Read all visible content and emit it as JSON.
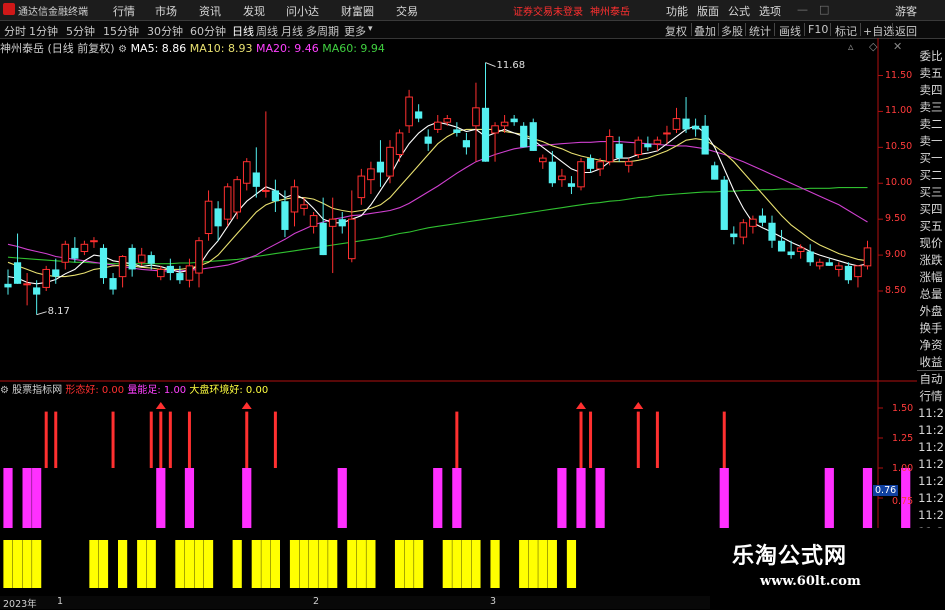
{
  "app": {
    "title": "通达信金融终端",
    "menu": [
      "行情",
      "市场",
      "资讯",
      "发现",
      "问小达",
      "财富圈",
      "交易"
    ],
    "notice": "证券交易未登录",
    "stock_tab": "神州泰岳",
    "right_menu": [
      "功能",
      "版面",
      "公式",
      "选项",
      "游客"
    ]
  },
  "toolbar": {
    "periods": [
      "分时",
      "1分钟",
      "5分钟",
      "15分钟",
      "30分钟",
      "60分钟",
      "日线",
      "周线",
      "月线",
      "多周期",
      "更多"
    ],
    "active_period": "日线",
    "tools": [
      "复权",
      "叠加",
      "多股",
      "统计",
      "画线",
      "F10",
      "标记",
      "+自选",
      "返回"
    ]
  },
  "info": {
    "stock": "神州泰岳",
    "mode": "(日线 前复权)",
    "ma5": "MA5: 8.86",
    "ma10": "MA10: 8.93",
    "ma20": "MA20: 9.46",
    "ma60": "MA60: 9.94"
  },
  "price_axis": [
    "11.50",
    "11.00",
    "10.50",
    "10.00",
    "9.50",
    "9.00",
    "8.50"
  ],
  "annotations": {
    "high": "11.68",
    "low": "8.17"
  },
  "indicator": {
    "name": "股票指标网",
    "l1": "形态好: 0.00",
    "l2": "量能足: 1.00",
    "l3": "大盘环境好: 0.00",
    "axis": [
      "1.50",
      "1.25",
      "1.00",
      "0.75"
    ],
    "current_value": "0.76"
  },
  "side_panel": [
    "委比",
    "卖五",
    "卖四",
    "卖三",
    "卖二",
    "卖一",
    "买一",
    "买二",
    "买三",
    "买四",
    "买五",
    "现价",
    "涨跌",
    "涨幅",
    "总量",
    "外盘",
    "换手",
    "净资",
    "收益",
    "自动",
    "行情",
    "11:2",
    "11:2",
    "11:2",
    "11:2",
    "11:2",
    "11:2",
    "11:2",
    "11:2"
  ],
  "bottom_axis": {
    "year": "2023年",
    "months": [
      "1",
      "2",
      "3"
    ]
  },
  "watermark": {
    "line1": "乐淘公式网",
    "line2": "www.60lt.com"
  },
  "colors": {
    "up": "#ff3030",
    "down": "#54f0f0",
    "ma5": "#ffffff",
    "ma10": "#e8e070",
    "ma20": "#d040d0",
    "ma60": "#30c030",
    "magenta": "#ff30ff",
    "yellow": "#ffff00",
    "axis": "#b01010"
  },
  "chart_data": {
    "type": "candlestick",
    "price_range": [
      8.17,
      11.68
    ],
    "candles": [
      {
        "o": 8.6,
        "h": 8.8,
        "l": 8.45,
        "c": 8.55
      },
      {
        "o": 8.9,
        "h": 9.3,
        "l": 8.6,
        "c": 8.6
      },
      {
        "o": 8.6,
        "h": 8.75,
        "l": 8.3,
        "c": 8.6
      },
      {
        "o": 8.55,
        "h": 8.65,
        "l": 8.17,
        "c": 8.45
      },
      {
        "o": 8.55,
        "h": 8.85,
        "l": 8.5,
        "c": 8.8
      },
      {
        "o": 8.8,
        "h": 8.95,
        "l": 8.6,
        "c": 8.7
      },
      {
        "o": 8.9,
        "h": 9.2,
        "l": 8.8,
        "c": 9.15
      },
      {
        "o": 9.1,
        "h": 9.25,
        "l": 8.9,
        "c": 8.95
      },
      {
        "o": 9.05,
        "h": 9.2,
        "l": 9.0,
        "c": 9.15
      },
      {
        "o": 9.2,
        "h": 9.25,
        "l": 9.1,
        "c": 9.2
      },
      {
        "o": 9.1,
        "h": 9.15,
        "l": 8.6,
        "c": 8.68
      },
      {
        "o": 8.68,
        "h": 8.75,
        "l": 8.45,
        "c": 8.52
      },
      {
        "o": 8.7,
        "h": 9.0,
        "l": 8.55,
        "c": 8.98
      },
      {
        "o": 9.1,
        "h": 9.15,
        "l": 8.7,
        "c": 8.8
      },
      {
        "o": 8.9,
        "h": 9.1,
        "l": 8.85,
        "c": 9.0
      },
      {
        "o": 9.0,
        "h": 9.05,
        "l": 8.8,
        "c": 8.88
      },
      {
        "o": 8.7,
        "h": 8.85,
        "l": 8.65,
        "c": 8.8
      },
      {
        "o": 8.85,
        "h": 8.95,
        "l": 8.65,
        "c": 8.75
      },
      {
        "o": 8.75,
        "h": 8.85,
        "l": 8.6,
        "c": 8.65
      },
      {
        "o": 8.65,
        "h": 8.95,
        "l": 8.55,
        "c": 8.85
      },
      {
        "o": 8.75,
        "h": 9.25,
        "l": 8.55,
        "c": 9.2
      },
      {
        "o": 9.3,
        "h": 9.9,
        "l": 9.2,
        "c": 9.75
      },
      {
        "o": 9.65,
        "h": 9.75,
        "l": 9.2,
        "c": 9.4
      },
      {
        "o": 9.5,
        "h": 10.0,
        "l": 9.4,
        "c": 9.95
      },
      {
        "o": 9.6,
        "h": 10.1,
        "l": 9.5,
        "c": 10.05
      },
      {
        "o": 10.0,
        "h": 10.35,
        "l": 9.9,
        "c": 10.3
      },
      {
        "o": 10.15,
        "h": 10.5,
        "l": 9.8,
        "c": 9.95
      },
      {
        "o": 9.9,
        "h": 11.0,
        "l": 9.8,
        "c": 9.9
      },
      {
        "o": 9.9,
        "h": 10.05,
        "l": 9.6,
        "c": 9.75
      },
      {
        "o": 9.75,
        "h": 9.9,
        "l": 9.25,
        "c": 9.35
      },
      {
        "o": 9.6,
        "h": 10.05,
        "l": 9.4,
        "c": 9.95
      },
      {
        "o": 9.65,
        "h": 9.8,
        "l": 9.55,
        "c": 9.7
      },
      {
        "o": 9.4,
        "h": 9.6,
        "l": 9.3,
        "c": 9.55
      },
      {
        "o": 9.45,
        "h": 9.8,
        "l": 9.0,
        "c": 9.0
      },
      {
        "o": 9.4,
        "h": 9.8,
        "l": 8.75,
        "c": 9.5
      },
      {
        "o": 9.5,
        "h": 9.6,
        "l": 9.3,
        "c": 9.4
      },
      {
        "o": 8.95,
        "h": 9.9,
        "l": 8.9,
        "c": 9.5
      },
      {
        "o": 9.8,
        "h": 10.2,
        "l": 9.7,
        "c": 10.1
      },
      {
        "o": 10.05,
        "h": 10.3,
        "l": 9.85,
        "c": 10.2
      },
      {
        "o": 10.3,
        "h": 10.6,
        "l": 9.95,
        "c": 10.15
      },
      {
        "o": 10.1,
        "h": 10.6,
        "l": 10.0,
        "c": 10.5
      },
      {
        "o": 10.4,
        "h": 10.75,
        "l": 10.3,
        "c": 10.7
      },
      {
        "o": 10.8,
        "h": 11.3,
        "l": 10.7,
        "c": 11.2
      },
      {
        "o": 11.0,
        "h": 11.1,
        "l": 10.85,
        "c": 10.9
      },
      {
        "o": 10.65,
        "h": 10.75,
        "l": 10.45,
        "c": 10.55
      },
      {
        "o": 10.75,
        "h": 10.95,
        "l": 10.7,
        "c": 10.85
      },
      {
        "o": 10.85,
        "h": 10.95,
        "l": 10.8,
        "c": 10.9
      },
      {
        "o": 10.75,
        "h": 10.85,
        "l": 10.65,
        "c": 10.7
      },
      {
        "o": 10.6,
        "h": 10.7,
        "l": 10.4,
        "c": 10.5
      },
      {
        "o": 10.8,
        "h": 11.4,
        "l": 10.3,
        "c": 11.05
      },
      {
        "o": 11.05,
        "h": 11.68,
        "l": 10.3,
        "c": 10.3
      },
      {
        "o": 10.7,
        "h": 10.85,
        "l": 10.3,
        "c": 10.8
      },
      {
        "o": 10.8,
        "h": 10.95,
        "l": 10.7,
        "c": 10.85
      },
      {
        "o": 10.9,
        "h": 10.95,
        "l": 10.8,
        "c": 10.85
      },
      {
        "o": 10.8,
        "h": 10.85,
        "l": 10.5,
        "c": 10.5
      },
      {
        "o": 10.85,
        "h": 10.9,
        "l": 10.45,
        "c": 10.45
      },
      {
        "o": 10.3,
        "h": 10.4,
        "l": 10.2,
        "c": 10.35
      },
      {
        "o": 10.3,
        "h": 10.45,
        "l": 9.95,
        "c": 10.0
      },
      {
        "o": 10.05,
        "h": 10.2,
        "l": 9.95,
        "c": 10.1
      },
      {
        "o": 10.0,
        "h": 10.1,
        "l": 9.85,
        "c": 9.95
      },
      {
        "o": 9.95,
        "h": 10.35,
        "l": 9.9,
        "c": 10.3
      },
      {
        "o": 10.35,
        "h": 10.4,
        "l": 10.15,
        "c": 10.2
      },
      {
        "o": 10.2,
        "h": 10.35,
        "l": 10.1,
        "c": 10.3
      },
      {
        "o": 10.3,
        "h": 10.75,
        "l": 10.25,
        "c": 10.65
      },
      {
        "o": 10.55,
        "h": 10.65,
        "l": 10.3,
        "c": 10.35
      },
      {
        "o": 10.25,
        "h": 10.35,
        "l": 10.15,
        "c": 10.3
      },
      {
        "o": 10.4,
        "h": 10.65,
        "l": 10.35,
        "c": 10.6
      },
      {
        "o": 10.55,
        "h": 10.65,
        "l": 10.45,
        "c": 10.5
      },
      {
        "o": 10.55,
        "h": 10.65,
        "l": 10.45,
        "c": 10.6
      },
      {
        "o": 10.7,
        "h": 10.8,
        "l": 10.55,
        "c": 10.7
      },
      {
        "o": 10.75,
        "h": 11.05,
        "l": 10.7,
        "c": 10.9
      },
      {
        "o": 10.9,
        "h": 11.2,
        "l": 10.7,
        "c": 10.75
      },
      {
        "o": 10.8,
        "h": 10.9,
        "l": 10.65,
        "c": 10.75
      },
      {
        "o": 10.8,
        "h": 10.95,
        "l": 10.4,
        "c": 10.4
      },
      {
        "o": 10.25,
        "h": 10.3,
        "l": 10.05,
        "c": 10.05
      },
      {
        "o": 10.05,
        "h": 10.1,
        "l": 9.35,
        "c": 9.35
      },
      {
        "o": 9.3,
        "h": 9.4,
        "l": 9.15,
        "c": 9.25
      },
      {
        "o": 9.25,
        "h": 9.5,
        "l": 9.15,
        "c": 9.45
      },
      {
        "o": 9.4,
        "h": 9.55,
        "l": 9.3,
        "c": 9.5
      },
      {
        "o": 9.55,
        "h": 9.65,
        "l": 9.4,
        "c": 9.45
      },
      {
        "o": 9.45,
        "h": 9.55,
        "l": 9.1,
        "c": 9.2
      },
      {
        "o": 9.2,
        "h": 9.35,
        "l": 9.05,
        "c": 9.05
      },
      {
        "o": 9.05,
        "h": 9.2,
        "l": 8.95,
        "c": 9.0
      },
      {
        "o": 9.05,
        "h": 9.15,
        "l": 8.95,
        "c": 9.1
      },
      {
        "o": 9.05,
        "h": 9.15,
        "l": 8.85,
        "c": 8.9
      },
      {
        "o": 8.85,
        "h": 8.95,
        "l": 8.8,
        "c": 8.9
      },
      {
        "o": 8.9,
        "h": 8.95,
        "l": 8.85,
        "c": 8.85
      },
      {
        "o": 8.8,
        "h": 8.9,
        "l": 8.7,
        "c": 8.85
      },
      {
        "o": 8.85,
        "h": 8.9,
        "l": 8.6,
        "c": 8.65
      },
      {
        "o": 8.7,
        "h": 8.85,
        "l": 8.55,
        "c": 8.85
      },
      {
        "o": 8.85,
        "h": 9.2,
        "l": 8.8,
        "c": 9.1
      }
    ],
    "ma5": [
      8.7,
      8.68,
      8.62,
      8.6,
      8.62,
      8.66,
      8.74,
      8.8,
      8.92,
      9.0,
      8.98,
      8.92,
      8.9,
      8.88,
      8.84,
      8.86,
      8.84,
      8.8,
      8.76,
      8.79,
      8.85,
      9.05,
      9.2,
      9.4,
      9.6,
      9.75,
      9.85,
      9.95,
      9.9,
      9.8,
      9.85,
      9.78,
      9.65,
      9.5,
      9.45,
      9.45,
      9.5,
      9.55,
      9.7,
      9.9,
      10.1,
      10.35,
      10.55,
      10.7,
      10.8,
      10.85,
      10.82,
      10.78,
      10.72,
      10.75,
      10.65,
      10.7,
      10.75,
      10.7,
      10.65,
      10.6,
      10.5,
      10.4,
      10.3,
      10.2,
      10.15,
      10.15,
      10.2,
      10.3,
      10.35,
      10.35,
      10.4,
      10.42,
      10.45,
      10.55,
      10.65,
      10.75,
      10.8,
      10.7,
      10.5,
      10.2,
      9.9,
      9.65,
      9.45,
      9.38,
      9.32,
      9.25,
      9.18,
      9.12,
      9.05,
      9.0,
      8.96,
      8.92,
      8.88,
      8.85,
      8.88
    ],
    "ma10": [
      8.9,
      8.85,
      8.8,
      8.75,
      8.72,
      8.7,
      8.7,
      8.72,
      8.75,
      8.8,
      8.82,
      8.85,
      8.86,
      8.85,
      8.83,
      8.82,
      8.8,
      8.8,
      8.8,
      8.82,
      8.85,
      8.9,
      9.0,
      9.15,
      9.3,
      9.45,
      9.6,
      9.7,
      9.75,
      9.78,
      9.8,
      9.8,
      9.78,
      9.72,
      9.65,
      9.62,
      9.6,
      9.62,
      9.65,
      9.7,
      9.8,
      9.95,
      10.1,
      10.25,
      10.4,
      10.55,
      10.65,
      10.72,
      10.75,
      10.75,
      10.75,
      10.75,
      10.72,
      10.7,
      10.68,
      10.62,
      10.58,
      10.52,
      10.48,
      10.42,
      10.38,
      10.35,
      10.32,
      10.3,
      10.3,
      10.3,
      10.32,
      10.35,
      10.4,
      10.45,
      10.52,
      10.6,
      10.62,
      10.6,
      10.52,
      10.42,
      10.3,
      10.15,
      10.0,
      9.85,
      9.7,
      9.55,
      9.42,
      9.32,
      9.22,
      9.14,
      9.08,
      9.02,
      8.98,
      8.94,
      8.92
    ],
    "ma20": [
      9.15,
      9.12,
      9.08,
      9.05,
      9.02,
      8.98,
      8.96,
      8.94,
      8.92,
      8.9,
      8.88,
      8.86,
      8.84,
      8.82,
      8.8,
      8.79,
      8.78,
      8.78,
      8.78,
      8.79,
      8.8,
      8.82,
      8.84,
      8.86,
      8.9,
      8.95,
      9.0,
      9.08,
      9.15,
      9.22,
      9.3,
      9.36,
      9.42,
      9.46,
      9.5,
      9.52,
      9.55,
      9.56,
      9.58,
      9.6,
      9.62,
      9.66,
      9.72,
      9.8,
      9.88,
      9.96,
      10.05,
      10.14,
      10.22,
      10.3,
      10.35,
      10.4,
      10.44,
      10.48,
      10.5,
      10.52,
      10.53,
      10.54,
      10.55,
      10.56,
      10.57,
      10.57,
      10.58,
      10.58,
      10.58,
      10.57,
      10.56,
      10.55,
      10.54,
      10.53,
      10.52,
      10.52,
      10.5,
      10.48,
      10.44,
      10.4,
      10.35,
      10.3,
      10.24,
      10.18,
      10.12,
      10.06,
      10.0,
      9.94,
      9.88,
      9.82,
      9.76,
      9.7,
      9.62,
      9.54,
      9.46
    ],
    "ma60": [
      8.97,
      8.96,
      8.95,
      8.94,
      8.93,
      8.92,
      8.91,
      8.9,
      8.9,
      8.89,
      8.89,
      8.88,
      8.88,
      8.88,
      8.88,
      8.88,
      8.88,
      8.88,
      8.89,
      8.89,
      8.9,
      8.91,
      8.92,
      8.93,
      8.94,
      8.96,
      8.98,
      9.0,
      9.02,
      9.04,
      9.06,
      9.08,
      9.1,
      9.12,
      9.14,
      9.16,
      9.18,
      9.2,
      9.22,
      9.24,
      9.27,
      9.3,
      9.32,
      9.35,
      9.38,
      9.4,
      9.42,
      9.44,
      9.46,
      9.48,
      9.5,
      9.52,
      9.54,
      9.56,
      9.58,
      9.6,
      9.62,
      9.64,
      9.66,
      9.68,
      9.7,
      9.72,
      9.73,
      9.75,
      9.76,
      9.78,
      9.8,
      9.81,
      9.83,
      9.84,
      9.85,
      9.86,
      9.87,
      9.88,
      9.88,
      9.89,
      9.89,
      9.9,
      9.9,
      9.91,
      9.91,
      9.92,
      9.92,
      9.92,
      9.93,
      9.93,
      9.93,
      9.94,
      9.94,
      9.94,
      9.94
    ],
    "red_signal_idx": [
      4,
      5,
      11,
      15,
      16,
      17,
      19,
      25,
      28,
      47,
      60,
      61,
      66,
      68,
      75
    ],
    "red_arrow_idx": [
      16,
      25,
      60,
      66
    ],
    "magenta_idx": [
      0,
      2,
      3,
      16,
      19,
      25,
      35,
      45,
      47,
      58,
      60,
      62,
      75,
      86,
      90,
      94
    ],
    "yellow_idx": [
      0,
      1,
      2,
      3,
      9,
      10,
      12,
      14,
      15,
      18,
      19,
      20,
      21,
      24,
      26,
      27,
      28,
      30,
      31,
      32,
      33,
      34,
      36,
      37,
      38,
      41,
      42,
      43,
      46,
      47,
      48,
      49,
      51,
      54,
      55,
      56,
      57,
      59
    ]
  }
}
